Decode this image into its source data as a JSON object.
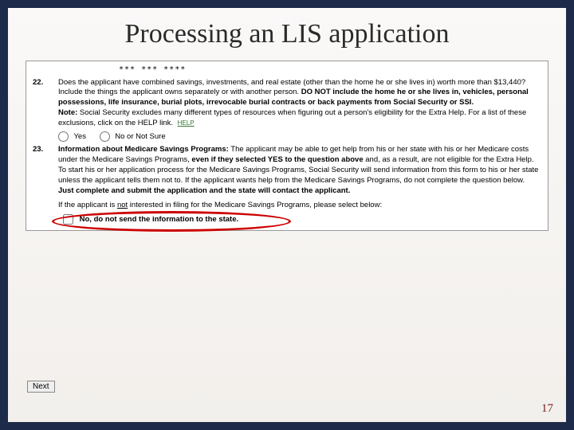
{
  "slide": {
    "title": "Processing an LIS application",
    "pageNumber": "17"
  },
  "mask": "***    ***    ****",
  "q22": {
    "number": "22.",
    "intro": "Does the applicant have combined savings, investments, and real estate (other than the home he or she lives in) worth more than $13,440? Include the things the applicant owns separately or with another person. ",
    "boldExclude": "DO NOT include the home he or she lives in, vehicles, personal possessions, life insurance, burial plots, irrevocable burial contracts or back payments from Social Security or SSI.",
    "noteLabel": "Note:",
    "noteText": " Social Security excludes many different types of resources when figuring out a person's eligibility for the Extra Help. For a list of these exclusions, click on the HELP link.",
    "helpLink": "HELP",
    "yes": "Yes",
    "no": "No or Not Sure"
  },
  "q23": {
    "number": "23.",
    "heading": "Information about Medicare Savings Programs:",
    "part1": " The applicant may be able to get help from his or her state with his or her Medicare costs under the Medicare Savings Programs, ",
    "bold1": "even if they selected YES to the question above",
    "part2": " and, as a result, are not eligible for the Extra Help. To start his or her application process for the Medicare Savings Programs, Social Security will send information from this form to his or her state unless the applicant tells them not to. If the applicant wants help from the Medicare Savings Programs, do not complete the question below. ",
    "bold2": "Just complete and submit the application and the state will contact the applicant.",
    "subIntro1": "If the applicant is ",
    "subNot": "not",
    "subIntro2": " interested in filing for the Medicare Savings Programs, please select below:",
    "checkboxLabel": "No, do not send the information to the state."
  },
  "nextButton": "Next"
}
